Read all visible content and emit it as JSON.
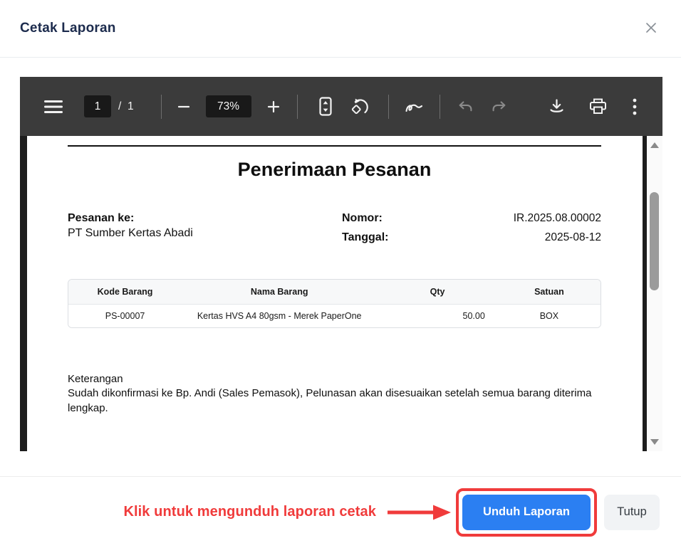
{
  "theme": {
    "annotation_red": "#f03b3b",
    "primary_blue": "#2b7ff2",
    "title_navy": "#1c2b4d"
  },
  "dialog": {
    "title": "Cetak Laporan"
  },
  "viewer": {
    "toolbar": {
      "page_current": "1",
      "page_divider": "/",
      "page_total": "1",
      "zoom_value": "73%",
      "icons": [
        "menu-icon",
        "zoom-out-icon",
        "zoom-in-icon",
        "fit-page-icon",
        "rotate-icon",
        "ink-annotate-icon",
        "undo-icon",
        "redo-icon",
        "download-icon",
        "print-icon",
        "more-options-icon"
      ]
    }
  },
  "report": {
    "title": "Penerimaan Pesanan",
    "order_to_label": "Pesanan ke:",
    "order_to_value": "PT Sumber Kertas Abadi",
    "number_label": "Nomor:",
    "number_value": "IR.2025.08.00002",
    "date_label": "Tanggal:",
    "date_value": "2025-08-12",
    "table": {
      "headers": [
        "Kode Barang",
        "Nama Barang",
        "Qty",
        "Satuan"
      ],
      "rows": [
        [
          "PS-00007",
          "Kertas HVS A4 80gsm - Merek PaperOne",
          "50.00",
          "BOX"
        ]
      ]
    },
    "notes_label": "Keterangan",
    "notes_text": "Sudah dikonfirmasi ke Bp. Andi (Sales Pemasok), Pelunasan akan disesuaikan setelah semua barang diterima lengkap."
  },
  "annotation": {
    "label": "Klik untuk mengunduh laporan cetak"
  },
  "footer": {
    "download_label": "Unduh Laporan",
    "close_label": "Tutup"
  }
}
